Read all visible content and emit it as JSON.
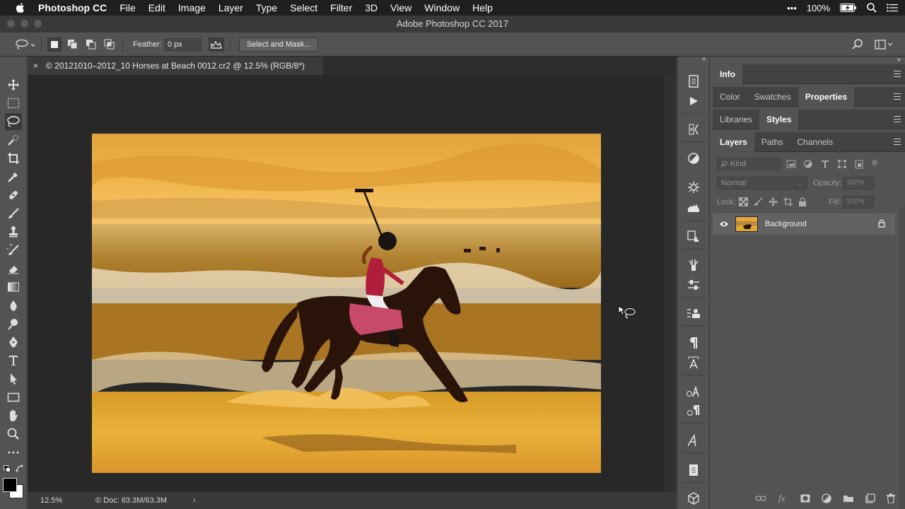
{
  "menubar": {
    "app_name": "Photoshop CC",
    "items": [
      "File",
      "Edit",
      "Image",
      "Layer",
      "Type",
      "Select",
      "Filter",
      "3D",
      "View",
      "Window",
      "Help"
    ],
    "more": "•••",
    "battery_percent": "100%"
  },
  "window": {
    "title": "Adobe Photoshop CC 2017"
  },
  "options": {
    "feather_label": "Feather:",
    "feather_value": "0 px",
    "select_mask_label": "Select and Mask..."
  },
  "document": {
    "tab_title": "© 20121010–2012_10 Horses at Beach 0012.cr2 @ 12.5% (RGB/8*)",
    "close_glyph": "×"
  },
  "status": {
    "zoom": "12.5%",
    "doc_info": "© Doc: 63.3M/63.3M",
    "arrow": "›"
  },
  "panels": {
    "group1": {
      "tabs": [
        "Info"
      ]
    },
    "group2": {
      "tabs": [
        "Color",
        "Swatches",
        "Properties"
      ],
      "active": "Properties"
    },
    "group3": {
      "tabs": [
        "Libraries",
        "Styles"
      ],
      "active": "Styles"
    },
    "group4": {
      "tabs": [
        "Layers",
        "Paths",
        "Channels"
      ],
      "active": "Layers"
    }
  },
  "layers": {
    "kind_placeholder": "Kind",
    "blend_mode": "Normal",
    "opacity_label": "Opacity:",
    "opacity_value": "100%",
    "lock_label": "Lock:",
    "fill_label": "Fill:",
    "fill_value": "100%",
    "items": [
      {
        "name": "Background",
        "visible": true,
        "locked": true
      }
    ]
  },
  "colors": {
    "accent": "#3a3a3a",
    "panel_bg": "#535353",
    "canvas_bg": "#282828"
  }
}
